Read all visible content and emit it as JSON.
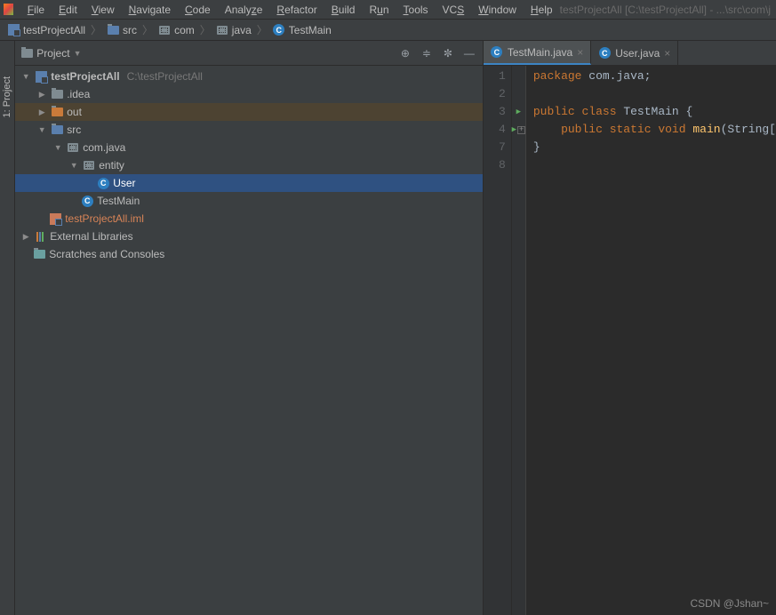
{
  "menubar": {
    "items": [
      "File",
      "Edit",
      "View",
      "Navigate",
      "Code",
      "Analyze",
      "Refactor",
      "Build",
      "Run",
      "Tools",
      "VCS",
      "Window",
      "Help"
    ],
    "title_right": "testProjectAll [C:\\testProjectAll] - ...\\src\\com\\j"
  },
  "breadcrumb": {
    "items": [
      {
        "icon": "module",
        "text": "testProjectAll"
      },
      {
        "icon": "folder-blue",
        "text": "src"
      },
      {
        "icon": "package",
        "text": "com"
      },
      {
        "icon": "package",
        "text": "java"
      },
      {
        "icon": "class",
        "text": "TestMain"
      }
    ]
  },
  "sidebar_tab": {
    "label": "1: Project"
  },
  "project_panel": {
    "title": "Project",
    "tree": {
      "root": {
        "label": "testProjectAll",
        "path": "C:\\testProjectAll"
      },
      "idea": ".idea",
      "out": "out",
      "src": "src",
      "package": "com.java",
      "entity": "entity",
      "user": "User",
      "testmain": "TestMain",
      "iml": "testProjectAll.iml",
      "ext": "External Libraries",
      "scratches": "Scratches and Consoles"
    }
  },
  "editor": {
    "tabs": [
      {
        "label": "TestMain.java",
        "active": true
      },
      {
        "label": "User.java",
        "active": false
      }
    ],
    "line_numbers": [
      "1",
      "2",
      "3",
      "4",
      "7",
      "8"
    ],
    "code": {
      "l1_kw": "package",
      "l1_rest": " com.java;",
      "l3": "public class TestMain {",
      "l4": "    public static void main(String[",
      "l7": "}",
      "l3_kw1": "public",
      "l3_kw2": "class",
      "l3_name": "TestMain",
      "l3_brace": " {",
      "l4_indent": "    ",
      "l4_kw1": "public",
      "l4_kw2": "static",
      "l4_kw3": "void",
      "l4_fn": "main",
      "l4_rest": "(String["
    }
  },
  "watermark": "CSDN @Jshan~"
}
